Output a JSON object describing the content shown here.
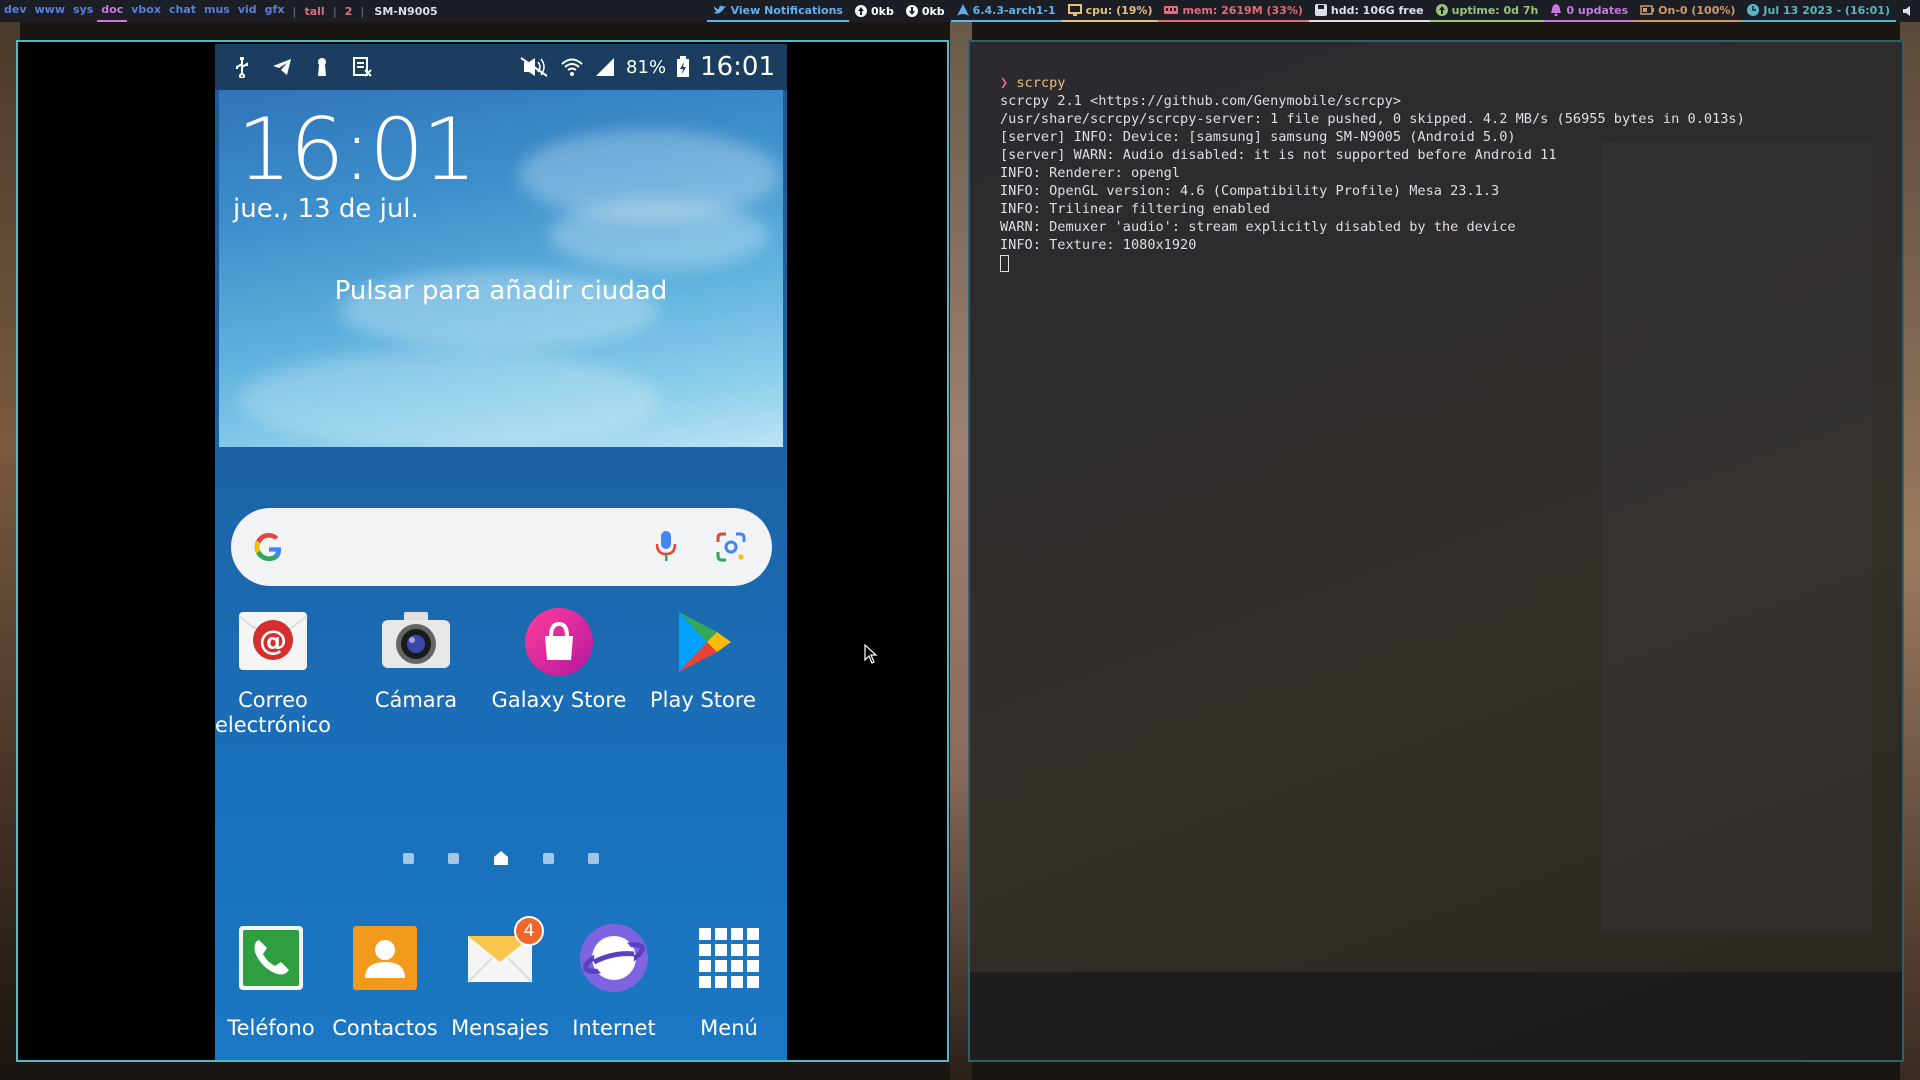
{
  "topbar": {
    "workspaces": [
      "dev",
      "www",
      "sys",
      "doc",
      "vbox",
      "chat",
      "mus",
      "vid",
      "gfx"
    ],
    "active_workspace": "doc",
    "layout": "tall",
    "window_count": "2",
    "window_title": "SM-N9005",
    "widgets": {
      "notifications": "View Notifications",
      "net_up": "0kb",
      "net_down": "0kb",
      "kernel": "6.4.3-arch1-1",
      "cpu": "cpu: (19%)",
      "mem": "mem: 2619M (33%)",
      "hdd": "hdd: 106G free",
      "uptime": "uptime: 0d 7h",
      "updates": "0 updates",
      "battery": "On-0 (100%)",
      "datetime": "Jul 13 2023 - (16:01)"
    }
  },
  "phone": {
    "statusbar": {
      "battery": "81%",
      "time": "16:01"
    },
    "weather_widget": {
      "clock": "16:01",
      "date": "jue., 13 de jul.",
      "city_prompt": "Pulsar para añadir ciudad"
    },
    "apps": [
      {
        "label_line1": "Correo",
        "label_line2": "electrónico",
        "icon": "email-icon"
      },
      {
        "label_line1": "Cámara",
        "label_line2": "",
        "icon": "camera-icon"
      },
      {
        "label_line1": "Galaxy Store",
        "label_line2": "",
        "icon": "galaxy-store-icon"
      },
      {
        "label_line1": "Play Store",
        "label_line2": "",
        "icon": "play-store-icon"
      }
    ],
    "dock": [
      {
        "label": "Teléfono",
        "icon": "phone-icon"
      },
      {
        "label": "Contactos",
        "icon": "contacts-icon"
      },
      {
        "label": "Mensajes",
        "icon": "messages-icon",
        "badge": "4"
      },
      {
        "label": "Internet",
        "icon": "internet-icon"
      },
      {
        "label": "Menú",
        "icon": "apps-grid-icon"
      }
    ]
  },
  "terminal": {
    "prompt_symbol": "❯",
    "command": "scrcpy",
    "output": [
      "scrcpy 2.1 <https://github.com/Genymobile/scrcpy>",
      "/usr/share/scrcpy/scrcpy-server: 1 file pushed, 0 skipped. 4.2 MB/s (56955 bytes in 0.013s)",
      "[server] INFO: Device: [samsung] samsung SM-N9005 (Android 5.0)",
      "[server] WARN: Audio disabled: it is not supported before Android 11",
      "INFO: Renderer: opengl",
      "INFO: OpenGL version: 4.6 (Compatibility Profile) Mesa 23.1.3",
      "INFO: Trilinear filtering enabled",
      "WARN: Demuxer 'audio': stream explicitly disabled by the device",
      "INFO: Texture: 1080x1920"
    ]
  }
}
